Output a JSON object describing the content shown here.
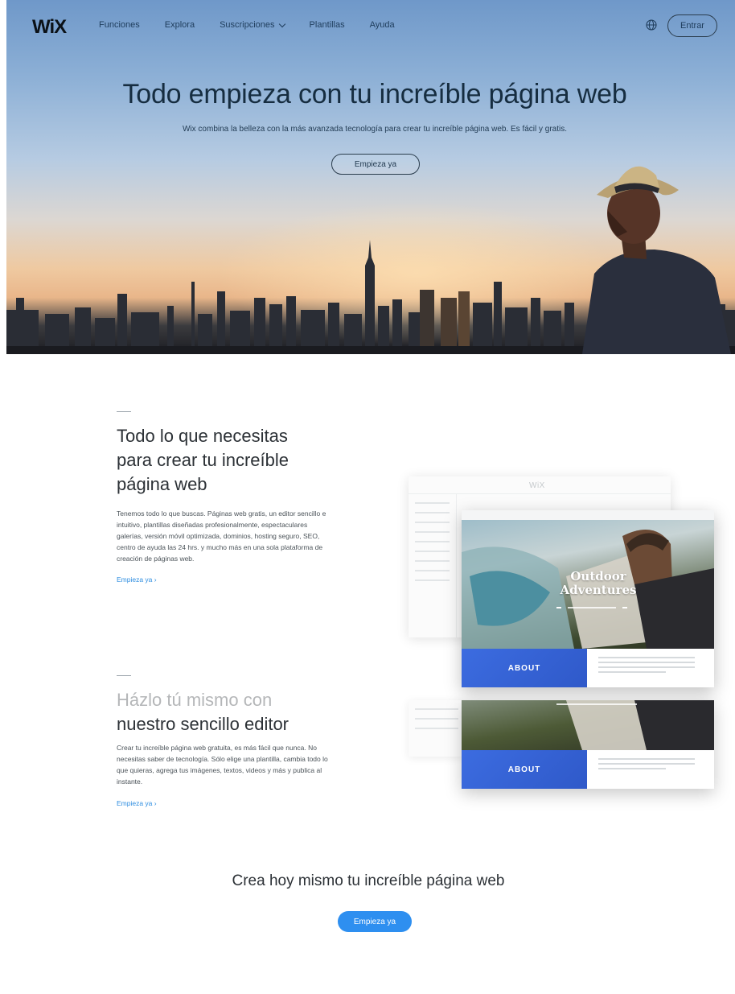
{
  "nav": {
    "logo": "WiX",
    "items": [
      {
        "label": "Funciones"
      },
      {
        "label": "Explora"
      },
      {
        "label": "Suscripciones",
        "has_dropdown": true
      },
      {
        "label": "Plantillas"
      },
      {
        "label": "Ayuda"
      }
    ],
    "language_icon": "globe-icon",
    "login_label": "Entrar"
  },
  "hero": {
    "title": "Todo empieza con tu increíble página web",
    "subtitle": "Wix combina la belleza con la más avanzada tecnología para crear tu increíble página web. Es fácil y gratis.",
    "cta_label": "Empieza ya"
  },
  "feature1": {
    "title_lines": [
      "Todo lo que necesitas",
      "para crear tu increíble",
      "página web"
    ],
    "description": "Tenemos todo lo que buscas. Páginas web gratis, un editor sencillo e intuitivo, plantillas diseñadas profesionalmente, espectaculares galerías, versión móvil optimizada, dominios, hosting seguro, SEO, centro de ayuda las 24 hrs. y mucho más en una sola plataforma de creación de páginas web.",
    "link_label": "Empieza ya ›"
  },
  "feature2": {
    "title_lines": [
      "Házlo tú mismo con",
      "nuestro sencillo editor"
    ],
    "description": "Crear tu increíble página web gratuita, es más fácil que nunca. No necesitas saber de tecnología. Sólo elige una plantilla, cambia todo lo que quieras, agrega tus imágenes, textos, videos y más y publica al instante.",
    "link_label": "Empieza ya ›"
  },
  "mockup": {
    "editor_logo": "WiX",
    "site_title": "Outdoor Adventures",
    "about_label": "ABOUT"
  },
  "bottom": {
    "title": "Crea hoy mismo tu increíble página web",
    "cta_label": "Empieza ya"
  },
  "colors": {
    "accent": "#2e8ff0",
    "about_blue": "#3263d6",
    "text_dark": "#2c3136"
  }
}
